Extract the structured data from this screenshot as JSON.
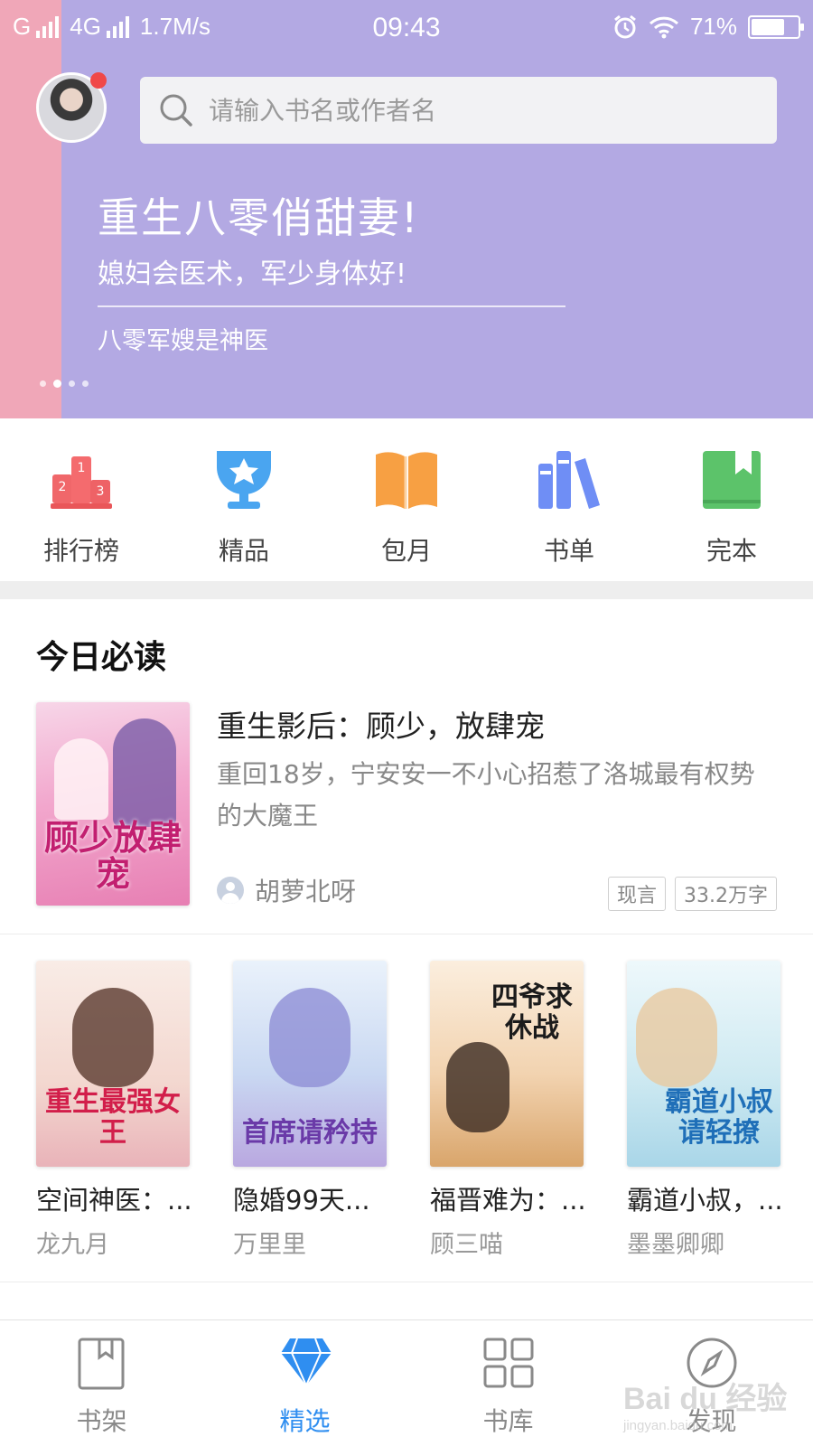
{
  "status_bar": {
    "carrier1": "G",
    "carrier2": "4G",
    "speed": "1.7M/s",
    "time": "09:43",
    "battery": "71%",
    "battery_level": 0.71
  },
  "search": {
    "placeholder": "请输入书名或作者名"
  },
  "banner": {
    "title": "重生八零俏甜妻!",
    "subtitle": "媳妇会医术，军少身体好!",
    "book_name": "八零军嫂是神医",
    "colors": {
      "main": "#b3a9e3",
      "left_strip": "#f0a7b8"
    }
  },
  "categories": [
    {
      "label": "排行榜",
      "icon": "podium-icon",
      "color": "#f0676a"
    },
    {
      "label": "精品",
      "icon": "trophy-icon",
      "color": "#4aa5f0"
    },
    {
      "label": "包月",
      "icon": "open-book-icon",
      "color": "#f7a043"
    },
    {
      "label": "书单",
      "icon": "bookshelf-icon",
      "color": "#6f8ef5"
    },
    {
      "label": "完本",
      "icon": "closed-book-icon",
      "color": "#5cc36a"
    }
  ],
  "today": {
    "section_title": "今日必读",
    "featured": {
      "cover_text": "顾少放肆宠",
      "title": "重生影后：顾少，放肆宠",
      "description": "重回18岁，宁安安一不小心招惹了洛城最有权势的大魔王",
      "author": "胡萝北呀",
      "tags": [
        "现言",
        "33.2万字"
      ]
    },
    "books": [
      {
        "cover_text": "重生最强女王",
        "name": "空间神医：...",
        "author": "龙九月"
      },
      {
        "cover_text": "首席请矜持",
        "name": "隐婚99天...",
        "author": "万里里"
      },
      {
        "cover_text": "四爷求休战",
        "name": "福晋难为：...",
        "author": "顾三喵"
      },
      {
        "cover_text": "霸道小叔请轻撩",
        "name": "霸道小叔，...",
        "author": "墨墨卿卿"
      }
    ]
  },
  "tabbar": {
    "items": [
      {
        "label": "书架",
        "icon": "bookmark-book-icon"
      },
      {
        "label": "精选",
        "icon": "diamond-icon"
      },
      {
        "label": "书库",
        "icon": "grid-icon"
      },
      {
        "label": "发现",
        "icon": "compass-icon"
      }
    ],
    "active_color": "#2f8ef0",
    "inactive_color": "#8a8a8a"
  },
  "watermark": {
    "main": "Bai du 经验",
    "sub": "jingyan.baidu.com"
  }
}
